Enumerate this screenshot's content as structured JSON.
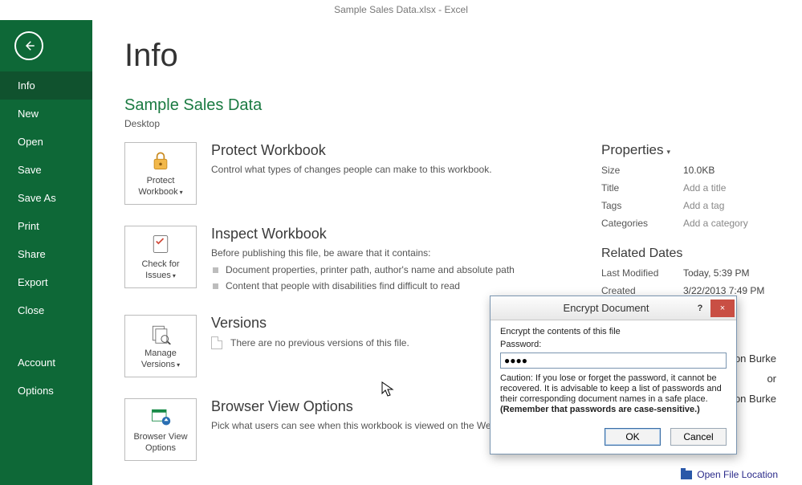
{
  "titlebar": "Sample Sales Data.xlsx - Excel",
  "sidebar": {
    "items": [
      {
        "label": "Info",
        "selected": true
      },
      {
        "label": "New"
      },
      {
        "label": "Open"
      },
      {
        "label": "Save"
      },
      {
        "label": "Save As"
      },
      {
        "label": "Print"
      },
      {
        "label": "Share"
      },
      {
        "label": "Export"
      },
      {
        "label": "Close"
      }
    ],
    "bottom": [
      {
        "label": "Account"
      },
      {
        "label": "Options"
      }
    ]
  },
  "page": {
    "title": "Info",
    "doc_title": "Sample Sales Data",
    "doc_location": "Desktop"
  },
  "cards": {
    "protect": {
      "line1": "Protect",
      "line2": "Workbook"
    },
    "check": {
      "line1": "Check for",
      "line2": "Issues"
    },
    "versions": {
      "line1": "Manage",
      "line2": "Versions"
    },
    "browser": {
      "line1": "Browser View",
      "line2": "Options"
    }
  },
  "sections": {
    "protect": {
      "heading": "Protect Workbook",
      "text": "Control what types of changes people can make to this workbook."
    },
    "inspect": {
      "heading": "Inspect Workbook",
      "text": "Before publishing this file, be aware that it contains:",
      "bullets": [
        "Document properties, printer path, author's name and absolute path",
        "Content that people with disabilities find difficult to read"
      ]
    },
    "versions": {
      "heading": "Versions",
      "text": "There are no previous versions of this file."
    },
    "browser": {
      "heading": "Browser View Options",
      "text": "Pick what users can see when this workbook is viewed on the Web."
    }
  },
  "properties": {
    "heading": "Properties",
    "rows": [
      {
        "k": "Size",
        "v": "10.0KB",
        "ph": false
      },
      {
        "k": "Title",
        "v": "Add a title",
        "ph": true
      },
      {
        "k": "Tags",
        "v": "Add a tag",
        "ph": true
      },
      {
        "k": "Categories",
        "v": "Add a category",
        "ph": true
      }
    ]
  },
  "dates": {
    "heading": "Related Dates",
    "rows": [
      {
        "k": "Last Modified",
        "v": "Today, 5:39 PM"
      },
      {
        "k": "Created",
        "v": "3/22/2013 7:49 PM"
      }
    ]
  },
  "partial_right": [
    "on Burke",
    "or",
    "on Burke"
  ],
  "footer_link": "Open File Location",
  "dialog": {
    "title": "Encrypt Document",
    "intro": "Encrypt the contents of this file",
    "pw_label": "Password:",
    "pw_value": "●●●●",
    "caution": "Caution: If you lose or forget the password, it cannot be recovered. It is advisable to keep a list of passwords and their corresponding document names in a safe place.",
    "caution2": "(Remember that passwords are case-sensitive.)",
    "ok": "OK",
    "cancel": "Cancel",
    "help": "?",
    "close": "×"
  }
}
